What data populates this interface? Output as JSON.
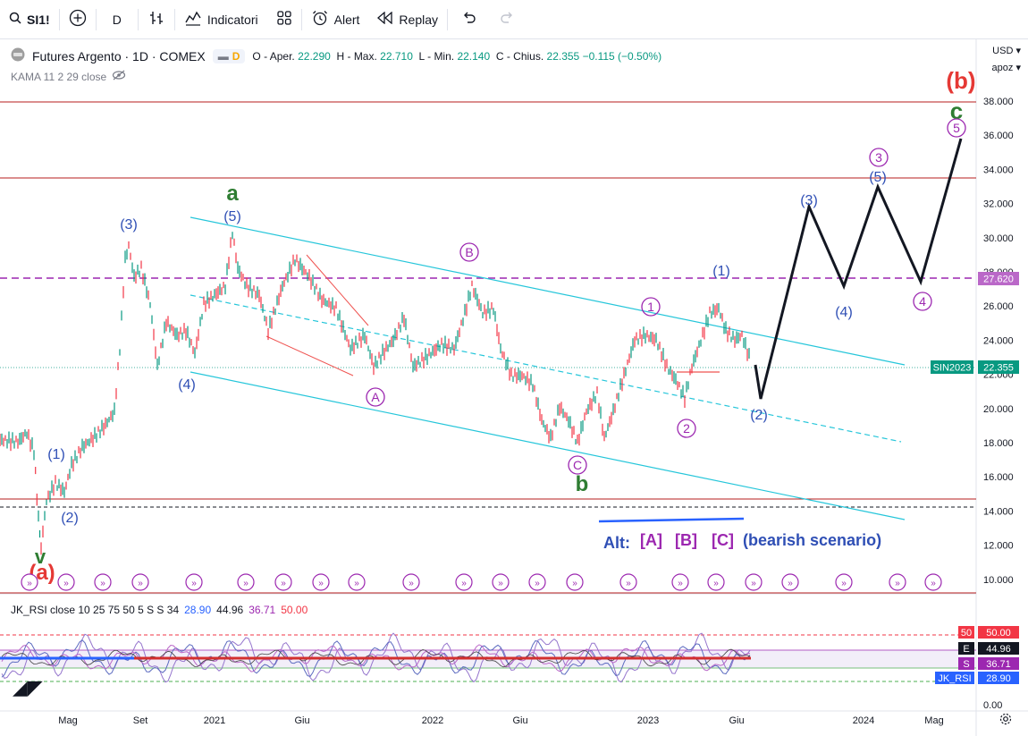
{
  "toolbar": {
    "symbol": "SI1!",
    "interval": "D",
    "indicators_label": "Indicatori",
    "alert_label": "Alert",
    "replay_label": "Replay"
  },
  "legend": {
    "title": "Futures Argento · 1D · COMEX",
    "pill_letter": "D",
    "o_label": "O - Aper.",
    "o_value": "22.290",
    "h_label": "H - Max.",
    "h_value": "22.710",
    "l_label": "L - Min.",
    "l_value": "22.140",
    "c_label": "C - Chius.",
    "c_value": "22.355",
    "change": "−0.115 (−0.50%)",
    "kama_label": "KAMA 11 2 29 close"
  },
  "currency": "USD",
  "scale_mode": "apoz",
  "price_axis": [
    "38.000",
    "36.000",
    "34.000",
    "32.000",
    "30.000",
    "28.000",
    "26.000",
    "24.000",
    "22.000",
    "20.000",
    "18.000",
    "16.000",
    "14.000",
    "12.000",
    "10.000"
  ],
  "price_badges": {
    "level": "27.620",
    "sin_label": "SIN2023",
    "sin_value": "22.355"
  },
  "time_axis": [
    "Mag",
    "Set",
    "2021",
    "Giu",
    "2022",
    "Giu",
    "2023",
    "Giu",
    "2024",
    "Mag"
  ],
  "rsi": {
    "legend_label": "JK_RSI close 10 25 75 50 5 S S 34",
    "v1": "28.90",
    "v2": "44.96",
    "v3": "36.71",
    "v4": "50.00",
    "axis_bottom": "0.00",
    "badges": [
      {
        "tag": "50",
        "value": "50.00",
        "color": "#f23645"
      },
      {
        "tag": "E",
        "value": "44.96",
        "color": "#131722"
      },
      {
        "tag": "S",
        "value": "36.71",
        "color": "#9c27b0"
      },
      {
        "tag": "JK_RSI",
        "value": "28.90",
        "color": "#2962ff"
      }
    ]
  },
  "annotations": {
    "wave_b_big": "(b)",
    "wave_c": "c",
    "wave_a": "a",
    "wave_b": "b",
    "wave_a_low": "(a)",
    "wave_v": "v",
    "circ5": "5",
    "circ3": "3",
    "circ4": "4",
    "circ1": "1",
    "circ2": "2",
    "circA": "A",
    "circB": "B",
    "circC": "C",
    "p3": "(3)",
    "p5": "(5)",
    "p4": "(4)",
    "p1": "(1)",
    "p2": "(2)",
    "alt_text": "Alt:",
    "alt_a": "[A]",
    "alt_b": "[B]",
    "alt_c": "[C]",
    "alt_note": "(bearish scenario)"
  },
  "colors": {
    "up": "#089981",
    "down": "#f23645",
    "channel": "#26c6da",
    "wave_blue": "#2f4fb5",
    "wave_purple": "#9c27b0",
    "wave_green": "#2e7d32",
    "wave_red": "#e53935"
  }
}
